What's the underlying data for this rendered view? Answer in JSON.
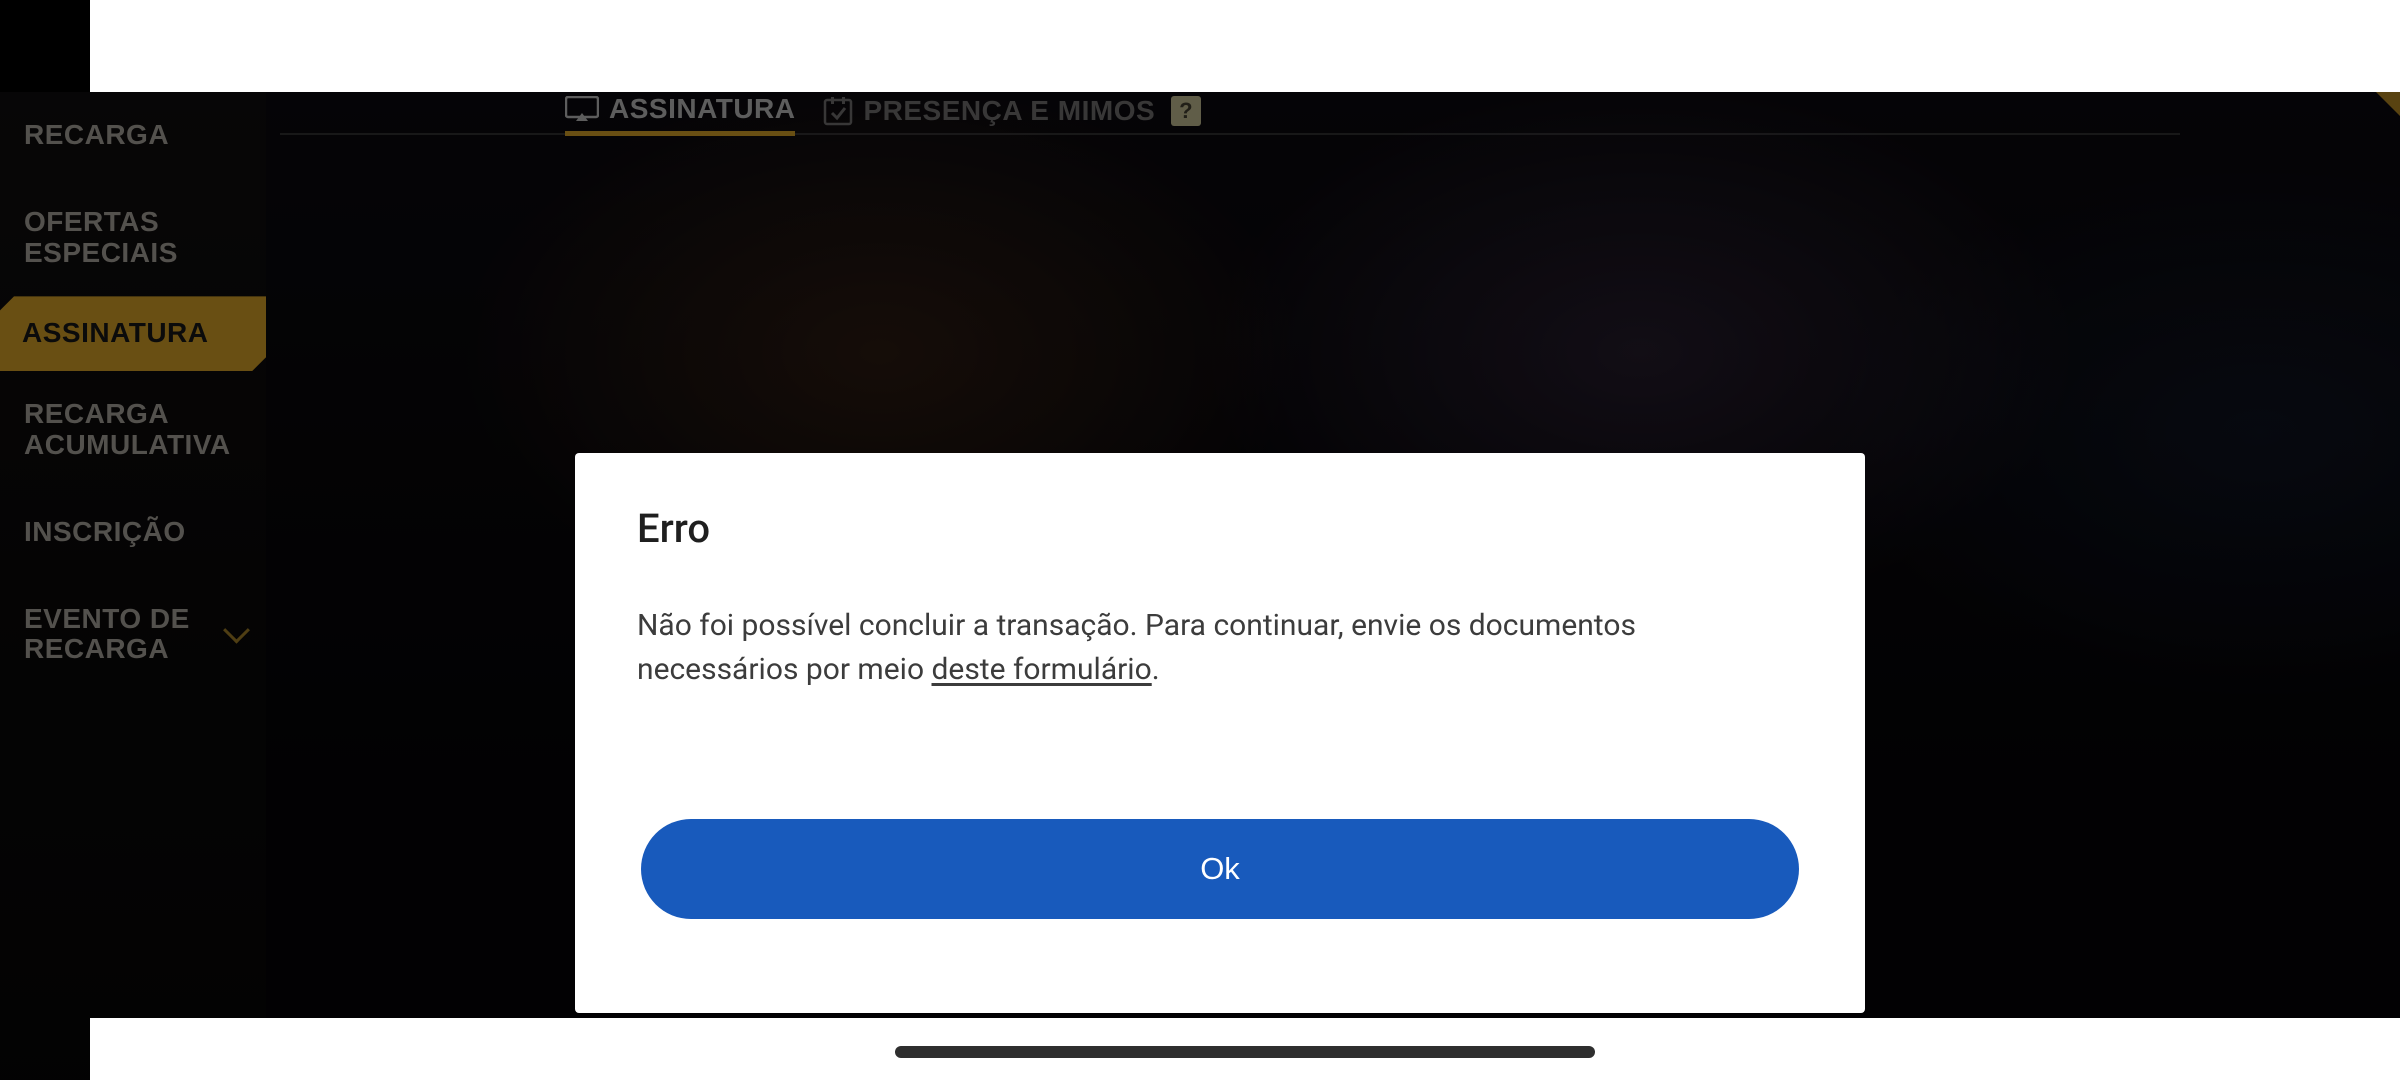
{
  "sidebar": {
    "items": [
      {
        "label": "RECARGA",
        "active": false,
        "expandable": false
      },
      {
        "label": "OFERTAS ESPECIAIS",
        "active": false,
        "expandable": false
      },
      {
        "label": "ASSINATURA",
        "active": true,
        "expandable": false
      },
      {
        "label": "RECARGA ACUMULATIVA",
        "active": false,
        "expandable": false
      },
      {
        "label": "INSCRIÇÃO",
        "active": false,
        "expandable": false
      },
      {
        "label": "EVENTO DE RECARGA",
        "active": false,
        "expandable": true
      }
    ]
  },
  "tabs": {
    "items": [
      {
        "label": "ASSINATURA",
        "active": true,
        "icon": "card-diamond-icon"
      },
      {
        "label": "PRESENÇA E MIMOS",
        "active": false,
        "icon": "calendar-check-icon",
        "help": "?"
      }
    ]
  },
  "modal": {
    "title": "Erro",
    "body_prefix": "Não foi possível concluir a transação. Para continuar, envie os documentos necessários por meio ",
    "body_link": "deste formulário",
    "body_suffix": ".",
    "ok_label": "Ok"
  }
}
